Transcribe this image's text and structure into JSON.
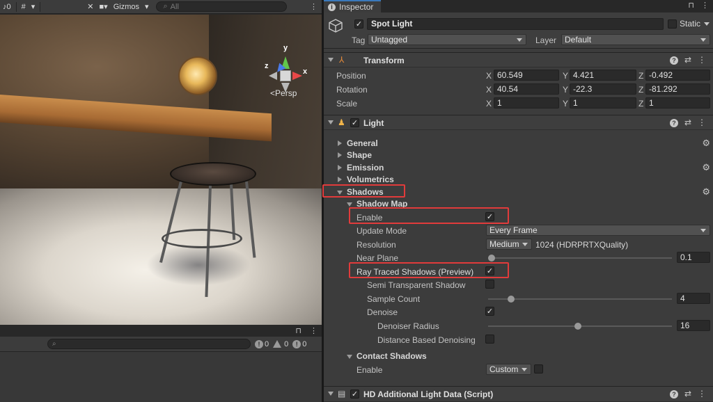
{
  "scene_toolbar": {
    "audio_label": "0",
    "gizmos_label": "Gizmos",
    "search_placeholder": "All",
    "more_icon": "more-vertical-icon"
  },
  "scene_view": {
    "axis_y": "y",
    "axis_x": "x",
    "axis_z": "z",
    "projection_label": "Persp"
  },
  "console": {
    "info_count": "0",
    "warning_count": "0",
    "error_count": "0"
  },
  "inspector": {
    "tab_title": "Inspector",
    "game_object": {
      "name": "Spot Light",
      "active": true,
      "static_label": "Static",
      "static": false,
      "tag_label": "Tag",
      "tag_value": "Untagged",
      "layer_label": "Layer",
      "layer_value": "Default"
    },
    "transform": {
      "title": "Transform",
      "position_label": "Position",
      "rotation_label": "Rotation",
      "scale_label": "Scale",
      "axis_x": "X",
      "axis_y": "Y",
      "axis_z": "Z",
      "position": {
        "x": "60.549",
        "y": "4.421",
        "z": "-0.492"
      },
      "rotation": {
        "x": "40.54",
        "y": "-22.3",
        "z": "-81.292"
      },
      "scale": {
        "x": "1",
        "y": "1",
        "z": "1"
      }
    },
    "light": {
      "title": "Light",
      "enabled": true,
      "sections": {
        "general": "General",
        "shape": "Shape",
        "emission": "Emission",
        "volumetrics": "Volumetrics",
        "shadows": "Shadows"
      },
      "shadow_map": {
        "title": "Shadow Map",
        "enable_label": "Enable",
        "enable": true,
        "update_mode_label": "Update Mode",
        "update_mode_value": "Every Frame",
        "resolution_label": "Resolution",
        "resolution_value": "Medium",
        "resolution_detail": "1024 (HDRPRTXQuality)",
        "near_plane_label": "Near Plane",
        "near_plane_value": "0.1",
        "near_plane_fraction": 0.0,
        "ray_traced_label": "Ray Traced Shadows (Preview)",
        "ray_traced": true,
        "semi_transparent_label": "Semi Transparent Shadow",
        "semi_transparent": false,
        "sample_count_label": "Sample Count",
        "sample_count_value": "4",
        "sample_count_fraction": 0.11,
        "denoise_label": "Denoise",
        "denoise": true,
        "denoiser_radius_label": "Denoiser Radius",
        "denoiser_radius_value": "16",
        "denoiser_radius_fraction": 0.49,
        "distance_denoising_label": "Distance Based Denoising",
        "distance_denoising": false
      },
      "contact_shadows": {
        "title": "Contact Shadows",
        "enable_label": "Enable",
        "enable_value": "Custom",
        "enable_override": false
      }
    },
    "hd_additional": {
      "title": "HD Additional Light Data (Script)",
      "enabled": true
    }
  }
}
